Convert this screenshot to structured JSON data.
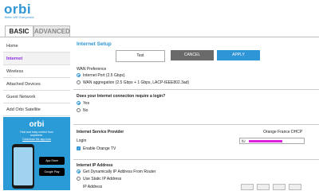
{
  "header": {
    "logo": "orbi",
    "tagline": "Better WiFi Everywhere"
  },
  "tabs": [
    {
      "label": "BASIC"
    },
    {
      "label": "ADVANCED"
    }
  ],
  "sidebar": {
    "items": [
      {
        "label": "Home"
      },
      {
        "label": "Internet"
      },
      {
        "label": "Wireless"
      },
      {
        "label": "Attached Devices"
      },
      {
        "label": "Guest Network"
      },
      {
        "label": "Add Orbi Satellite"
      }
    ]
  },
  "promo": {
    "logo": "orbi",
    "text1": "Fast and easy control from",
    "text2": "anywhere.",
    "link": "Download the app now",
    "app_store": "App Store",
    "google_play": "Google Play"
  },
  "page": {
    "title": "Internet Setup",
    "buttons": {
      "test": "Test",
      "cancel": "CANCEL",
      "apply": "APPLY"
    },
    "wan": {
      "label": "WAN Preference",
      "opt1": "Internet Port (2.5 Gbps)",
      "opt2": "WAN aggregation (2.5 Gbps + 1 Gbps, LACP-IEEE802.3ad)"
    },
    "login_q": {
      "label": "Does your Internet connection require a login?",
      "yes": "Yes",
      "no": "No"
    },
    "isp": {
      "label": "Internet Service Provider",
      "value": "Orange France DHCP",
      "login_label": "Login",
      "login_value": "fti/",
      "enable_tv": "Enable Orange TV"
    },
    "ip": {
      "label": "Internet IP Address",
      "opt1": "Get Dynamically IP Address From Router",
      "opt2": "Use Static IP Address",
      "field": "IP Address"
    }
  },
  "colors": {
    "accent": "#2e95d6",
    "active": "#8a2be2",
    "cancel": "#6a6a6a"
  }
}
